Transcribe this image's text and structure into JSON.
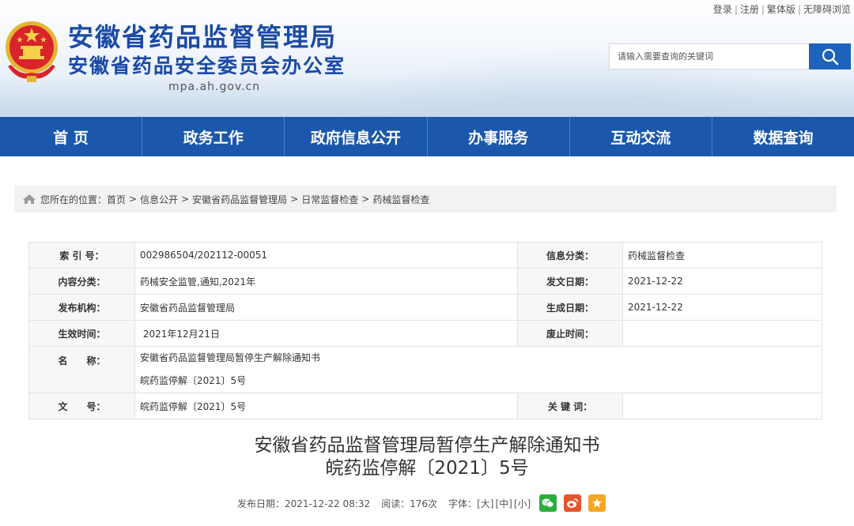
{
  "header": {
    "title_main": "安徽省药品监督管理局",
    "title_sub": "安徽省药品安全委员会办公室",
    "domain": "mpa.ah.gov.cn",
    "top_links": [
      "登录",
      "注册",
      "繁体版",
      "无障碍浏览"
    ],
    "search_placeholder": "请输入需要查询的关键词",
    "search_icon": "search-icon",
    "emblem_icon": "national-emblem-icon"
  },
  "nav": {
    "items": [
      "首 页",
      "政务工作",
      "政府信息公开",
      "办事服务",
      "互动交流",
      "数据查询"
    ]
  },
  "breadcrumb": {
    "prefix": "您所在的位置：",
    "items": [
      "首页",
      "信息公开",
      "安徽省药品监督管理局",
      "日常监督检查",
      "药械监督检查"
    ],
    "separator": ">"
  },
  "meta": {
    "index_label": "索 引 号：",
    "index_value": "002986504/202112-00051",
    "category_label": "信息分类：",
    "category_value": "药械监督检查",
    "content_label": "内容分类：",
    "content_value": "药械安全监管,通知,2021年",
    "publish_date_label": "发文日期：",
    "publish_date_value": "2021-12-22",
    "org_label": "发布机构：",
    "org_value": "安徽省药品监督管理局",
    "created_label": "生成日期：",
    "created_value": "2021-12-22",
    "effective_label": "生效时间：",
    "effective_value": " 2021年12月21日",
    "expire_label": "废止时间：",
    "expire_value": "",
    "name_label": "名　　称：",
    "name_line1": "安徽省药品监督管理局暂停生产解除通知书",
    "name_line2": "皖药监停解〔2021〕5号",
    "docno_label": "文　　号：",
    "docno_value": "皖药监停解〔2021〕5号",
    "keywords_label": "关 键 词：",
    "keywords_value": ""
  },
  "article": {
    "title_line1": "安徽省药品监督管理局暂停生产解除通知书",
    "title_line2": "皖药监停解〔2021〕5号",
    "publish_time": "发布日期：2021-12-22 08:32",
    "reads": "阅读：176次",
    "font_label": "字体：",
    "font_sizes": [
      "[大]",
      "[中]",
      "[小]"
    ],
    "share_icons": [
      "wechat-icon",
      "weibo-icon",
      "favorite-icon"
    ],
    "share_colors": [
      "#2bae3f",
      "#e8532d",
      "#f5a623"
    ]
  },
  "colors": {
    "brand_blue": "#1b4aa6",
    "nav_blue": "#1b58ab",
    "search_button": "#1d62bb"
  }
}
